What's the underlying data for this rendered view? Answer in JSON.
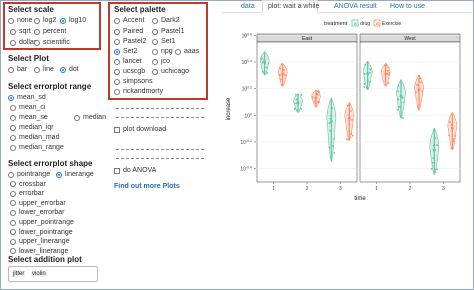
{
  "scale": {
    "heading": "Select scale",
    "options": [
      "none",
      "log2",
      "log10",
      "sqrt",
      "percent",
      "dollar",
      "scientific"
    ],
    "selected": "log10"
  },
  "plot": {
    "heading": "Select Plot",
    "options": [
      "bar",
      "line",
      "dot"
    ],
    "selected": "dot"
  },
  "errorplot_range": {
    "heading": "Select errorplot range",
    "options": [
      "mean_sd",
      "mean_ci",
      "mean_se",
      "median",
      "median_iqr",
      "median_mad",
      "median_range"
    ],
    "selected": "mean_sd"
  },
  "errorplot_shape": {
    "heading": "Select errorplot shape",
    "options": [
      "pointrange",
      "linerange",
      "crossbar",
      "errorbar",
      "upper_errorbar",
      "lower_errorbar",
      "upper_pointrange",
      "lower_pointrange",
      "upper_linerange",
      "lower_linerange"
    ],
    "selected": "linerange"
  },
  "addition_plot": {
    "heading": "Select addition plot",
    "tags": [
      "jitter",
      "violin"
    ]
  },
  "palette": {
    "heading": "Select palette",
    "options": [
      "Accent",
      "Dark2",
      "Paired",
      "Pastel1",
      "Pastel2",
      "Set1",
      "Set2",
      "npg",
      "aaas",
      "lancet",
      "jco",
      "ucscgb",
      "uchicago",
      "simpsons",
      "rickandmorty"
    ],
    "selected": "Set2"
  },
  "download": {
    "label": "plot download"
  },
  "anova": {
    "label": "do ANOVA"
  },
  "find_more": {
    "label": "Find out more Plots"
  },
  "tabs": {
    "data": "data",
    "plot": "plot: wait a while",
    "anova": "ANOVA result",
    "howto": "How to use"
  },
  "chart": {
    "legend_title": "treatment",
    "legend_items": [
      "drug",
      "Exercise"
    ],
    "colors": {
      "drug": "#66c2a5",
      "exercise": "#fc8d62"
    },
    "facets": [
      "East",
      "West"
    ],
    "ylabel": "increase",
    "xlabel": "time",
    "xticks": [
      "1",
      "2",
      "3"
    ],
    "yticks": [
      "10^0.6",
      "10^0.4",
      "10^0.2",
      "10^0",
      "10^-0.2",
      "10^-0.4"
    ]
  },
  "chart_data": {
    "type": "scatter",
    "title": "",
    "xlabel": "time",
    "ylabel": "increase",
    "yscale": "log10",
    "categories": [
      "1",
      "2",
      "3"
    ],
    "facets": [
      "East",
      "West"
    ],
    "series": [
      {
        "name": "drug",
        "facet": "East",
        "means": [
          2.5,
          1.25,
          0.9
        ],
        "sd": [
          0.5,
          0.2,
          0.45
        ]
      },
      {
        "name": "Exercise",
        "facet": "East",
        "means": [
          2.05,
          1.35,
          0.95
        ],
        "sd": [
          0.4,
          0.2,
          0.3
        ]
      },
      {
        "name": "drug",
        "facet": "West",
        "means": [
          2.05,
          1.4,
          0.55
        ],
        "sd": [
          0.5,
          0.45,
          0.25
        ]
      },
      {
        "name": "Exercise",
        "facet": "West",
        "means": [
          2.05,
          1.55,
          0.8
        ],
        "sd": [
          0.4,
          0.45,
          0.25
        ]
      }
    ]
  }
}
